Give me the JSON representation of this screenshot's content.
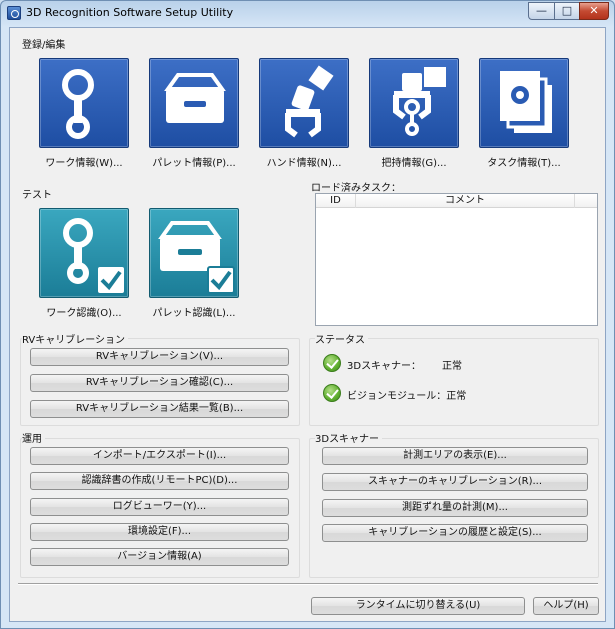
{
  "window": {
    "title": "3D Recognition Software Setup Utility"
  },
  "colors": {
    "tile_blue": "#2a5bb3",
    "tile_teal": "#2791ab",
    "ok_green": "#5fae2e"
  },
  "register_edit": {
    "title": "登録/編集",
    "tiles": [
      {
        "label": "ワーク情報(W)...",
        "icon": "workpiece-icon"
      },
      {
        "label": "パレット情報(P)...",
        "icon": "pallet-icon"
      },
      {
        "label": "ハンド情報(N)...",
        "icon": "hand-icon"
      },
      {
        "label": "把持情報(G)...",
        "icon": "grip-icon"
      },
      {
        "label": "タスク情報(T)...",
        "icon": "task-icon"
      }
    ]
  },
  "test": {
    "title": "テスト",
    "tiles": [
      {
        "label": "ワーク認識(O)...",
        "icon": "workpiece-check-icon"
      },
      {
        "label": "パレット認識(L)...",
        "icon": "pallet-check-icon"
      }
    ]
  },
  "loaded_tasks": {
    "title": "ロード済みタスク：",
    "columns": [
      "ID",
      "コメント"
    ]
  },
  "rv_calibration": {
    "title": "RVキャリブレーション",
    "buttons": [
      "RVキャリブレーション(V)...",
      "RVキャリブレーション確認(C)...",
      "RVキャリブレーション結果一覧(B)..."
    ]
  },
  "status": {
    "title": "ステータス",
    "rows": [
      {
        "label": "3Dスキャナー：",
        "value": "正常"
      },
      {
        "label": "ビジョンモジュール：正常",
        "value": ""
      }
    ]
  },
  "operation": {
    "title": "運用",
    "buttons": [
      "インポート/エクスポート(I)...",
      "認識辞書の作成(リモートPC)(D)...",
      "ログビューワー(Y)...",
      "環境設定(F)...",
      "バージョン情報(A)"
    ]
  },
  "scanner": {
    "title": "3Dスキャナー",
    "buttons": [
      "計測エリアの表示(E)...",
      "スキャナーのキャリブレーション(R)...",
      "測距ずれ量の計測(M)...",
      "キャリブレーションの履歴と設定(S)..."
    ]
  },
  "footer": {
    "runtime_label": "ランタイムに切り替える(U)",
    "help_label": "ヘルプ(H)"
  }
}
